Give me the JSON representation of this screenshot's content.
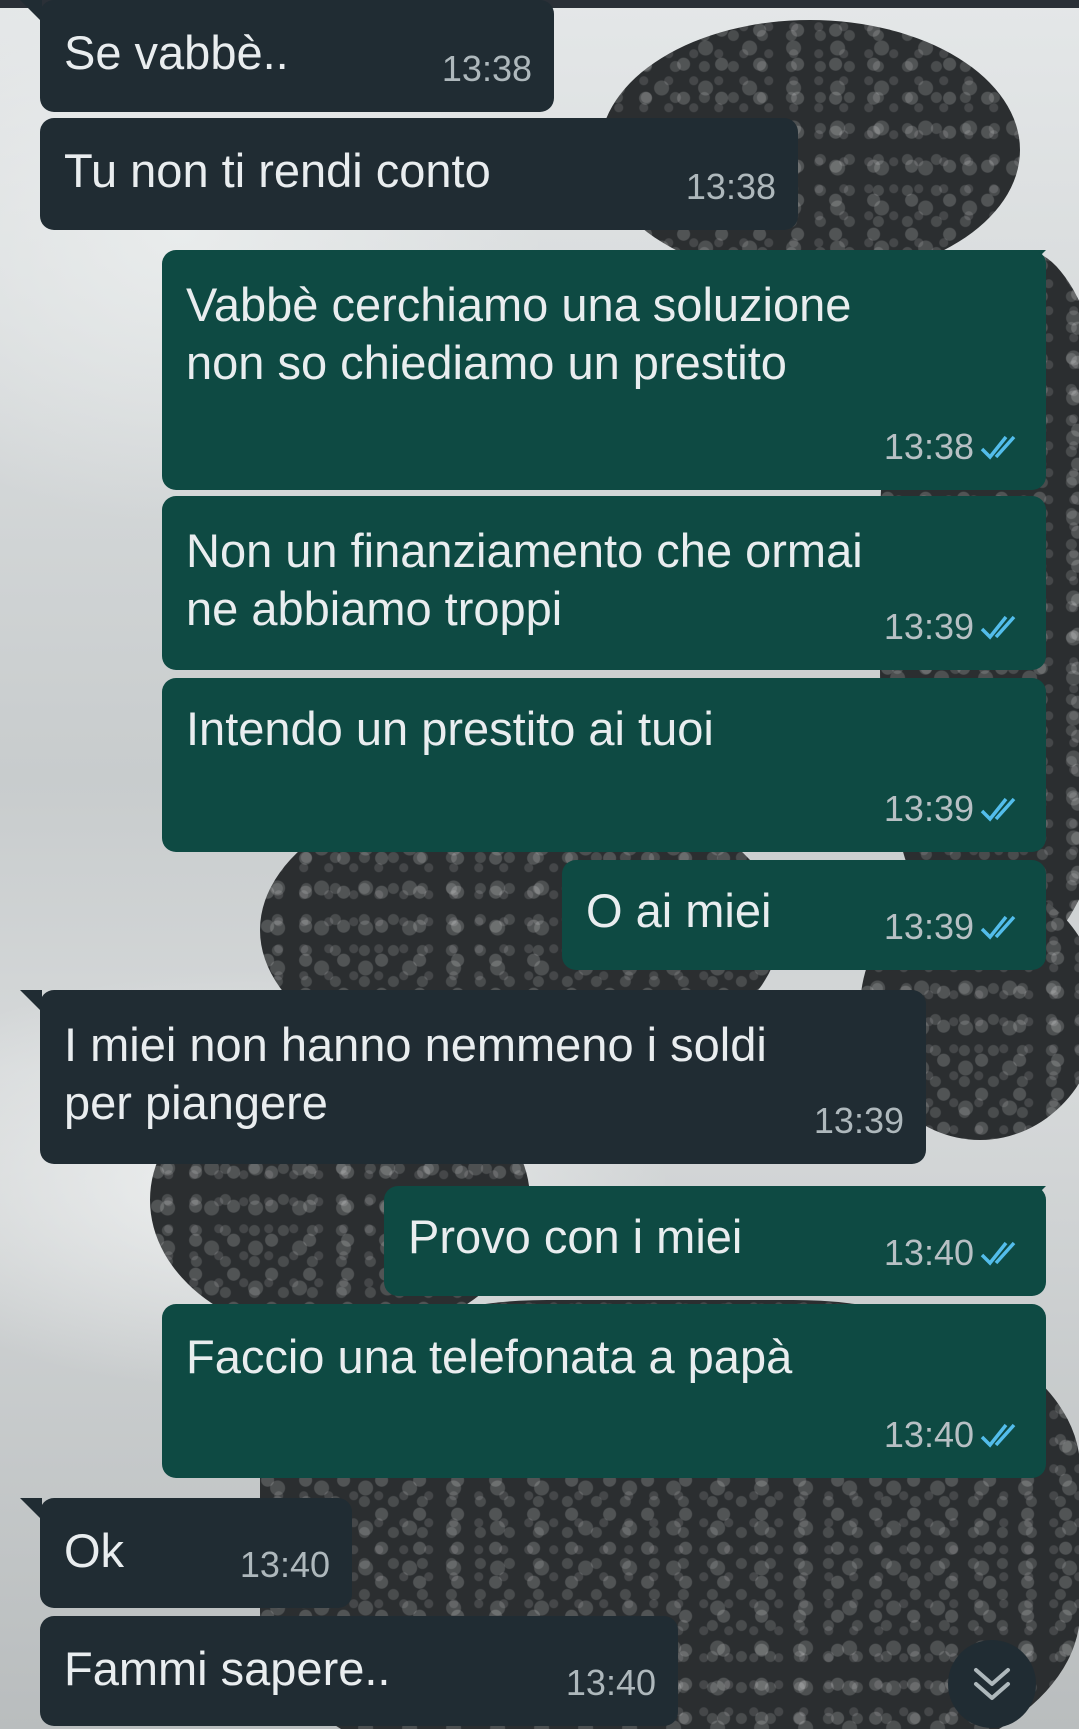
{
  "messages": [
    {
      "text": "Se vabbè..",
      "time": "13:38",
      "direction": "incoming"
    },
    {
      "text": "Tu non ti rendi conto",
      "time": "13:38",
      "direction": "incoming"
    },
    {
      "text": "Vabbè cerchiamo una soluzione\nnon so chiediamo un prestito",
      "time": "13:38",
      "direction": "outgoing",
      "status": "read"
    },
    {
      "text": "Non un finanziamento che ormai\nne abbiamo troppi",
      "time": "13:39",
      "direction": "outgoing",
      "status": "read"
    },
    {
      "text": "Intendo un prestito ai tuoi",
      "time": "13:39",
      "direction": "outgoing",
      "status": "read"
    },
    {
      "text": "O ai miei",
      "time": "13:39",
      "direction": "outgoing",
      "status": "read"
    },
    {
      "text": "I miei non hanno nemmeno i soldi\nper piangere",
      "time": "13:39",
      "direction": "incoming"
    },
    {
      "text": "Provo con i miei",
      "time": "13:40",
      "direction": "outgoing",
      "status": "read"
    },
    {
      "text": "Faccio una telefonata a papà",
      "time": "13:40",
      "direction": "outgoing",
      "status": "read"
    },
    {
      "text": "Ok",
      "time": "13:40",
      "direction": "incoming"
    },
    {
      "text": "Fammi sapere..",
      "time": "13:40",
      "direction": "incoming"
    }
  ],
  "icons": {
    "read_receipt": "double-check-icon",
    "scroll_down": "chevron-double-down-icon"
  },
  "colors": {
    "incoming_bubble": "#202c33",
    "outgoing_bubble": "#0e4a43",
    "read_ticks": "#53bdeb",
    "text": "#e9edef"
  }
}
